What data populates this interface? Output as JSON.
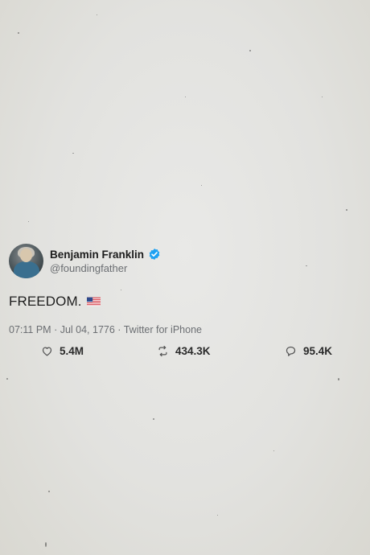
{
  "tweet": {
    "name": "Benjamin Franklin",
    "handle": "@foundingfather",
    "text": "FREEDOM.",
    "time": "07:11 PM",
    "date": "Jul 04, 1776",
    "source": "Twitter for iPhone",
    "likes": "5.4M",
    "retweets": "434.3K",
    "replies": "95.4K"
  },
  "colors": {
    "verified": "#1da1f2",
    "background": "#e4e4e1",
    "muted_text": "#6b6e72"
  },
  "icons": {
    "verified": "verified-badge-icon",
    "flag": "us-flag-icon",
    "like": "heart-icon",
    "retweet": "retweet-icon",
    "reply": "reply-icon"
  }
}
